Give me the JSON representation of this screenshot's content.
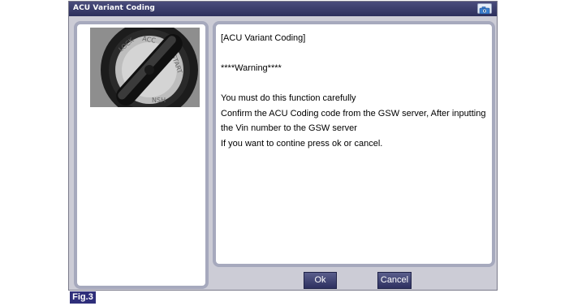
{
  "window": {
    "title": "ACU Variant Coding",
    "camera_icon": "camera-icon"
  },
  "image": {
    "icon": "ignition-switch-photo"
  },
  "message": {
    "heading": "[ACU Variant Coding]",
    "warning": "****Warning****",
    "line1": "You must do this function carefully",
    "line2": "Confirm the ACU Coding code from the GSW server, After inputting",
    "line3": "the Vin number to the GSW server",
    "line4": "If you want to contine press ok or cancel."
  },
  "buttons": {
    "ok_label": "Ok",
    "cancel_label": "Cancel"
  },
  "figure": {
    "label": "Fig.3"
  },
  "colors": {
    "titlebar": "#2c2f5c",
    "window_bg": "#ccccd6",
    "panel_border": "#a6a9bd",
    "button_bg": "#3a3d6c",
    "fig_label_bg": "#2e2e7a"
  }
}
